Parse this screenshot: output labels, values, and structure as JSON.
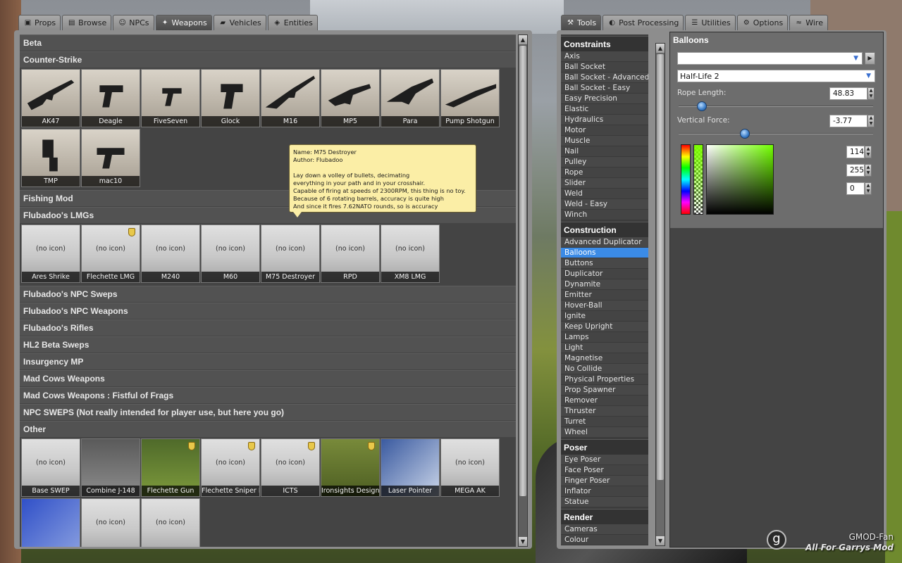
{
  "left_tabs": [
    {
      "label": "Props",
      "icon": "props-icon",
      "active": false
    },
    {
      "label": "Browse",
      "icon": "browse-icon",
      "active": false
    },
    {
      "label": "NPCs",
      "icon": "npcs-icon",
      "active": false
    },
    {
      "label": "Weapons",
      "icon": "weapons-icon",
      "active": true
    },
    {
      "label": "Vehicles",
      "icon": "vehicles-icon",
      "active": false
    },
    {
      "label": "Entities",
      "icon": "entities-icon",
      "active": false
    }
  ],
  "right_tabs": [
    {
      "label": "Tools",
      "icon": "wrench-icon",
      "active": true
    },
    {
      "label": "Post Processing",
      "icon": "post-processing-icon",
      "active": false
    },
    {
      "label": "Utilities",
      "icon": "utilities-icon",
      "active": false
    },
    {
      "label": "Options",
      "icon": "options-icon",
      "active": false
    },
    {
      "label": "Wire",
      "icon": "wire-icon",
      "active": false
    }
  ],
  "weapon_categories": [
    {
      "name": "Beta",
      "items": []
    },
    {
      "name": "Counter-Strike",
      "items": [
        {
          "label": "AK47",
          "icon": true,
          "admin": false
        },
        {
          "label": "Deagle",
          "icon": true,
          "admin": false
        },
        {
          "label": "FiveSeven",
          "icon": true,
          "admin": false
        },
        {
          "label": "Glock",
          "icon": true,
          "admin": false
        },
        {
          "label": "M16",
          "icon": true,
          "admin": false
        },
        {
          "label": "MP5",
          "icon": true,
          "admin": false
        },
        {
          "label": "Para",
          "icon": true,
          "admin": false
        },
        {
          "label": "Pump Shotgun",
          "icon": true,
          "admin": false
        },
        {
          "label": "TMP",
          "icon": true,
          "admin": false
        },
        {
          "label": "mac10",
          "icon": true,
          "admin": false
        }
      ]
    },
    {
      "name": "Fishing Mod",
      "items": []
    },
    {
      "name": "Flubadoo's LMGs",
      "items": [
        {
          "label": "Ares Shrike",
          "icon": false,
          "admin": false
        },
        {
          "label": "Flechette LMG",
          "icon": false,
          "admin": true
        },
        {
          "label": "M240",
          "icon": false,
          "admin": false
        },
        {
          "label": "M60",
          "icon": false,
          "admin": false
        },
        {
          "label": "M75 Destroyer",
          "icon": false,
          "admin": false
        },
        {
          "label": "RPD",
          "icon": false,
          "admin": false
        },
        {
          "label": "XM8 LMG",
          "icon": false,
          "admin": false
        }
      ]
    },
    {
      "name": "Flubadoo's NPC Sweps",
      "items": []
    },
    {
      "name": "Flubadoo's NPC Weapons",
      "items": []
    },
    {
      "name": "Flubadoo's Rifles",
      "items": []
    },
    {
      "name": "HL2 Beta Sweps",
      "items": []
    },
    {
      "name": "Insurgency MP",
      "items": []
    },
    {
      "name": "Mad Cows Weapons",
      "items": []
    },
    {
      "name": "Mad Cows Weapons : Fistful of Frags",
      "items": []
    },
    {
      "name": "NPC SWEPS (Not really intended for player use, but here you go)",
      "items": []
    },
    {
      "name": "Other",
      "items": [
        {
          "label": "Base SWEP",
          "icon": false,
          "admin": false
        },
        {
          "label": "Combine J-148",
          "icon": true,
          "admin": false
        },
        {
          "label": "Flechette Gun",
          "icon": true,
          "admin": true
        },
        {
          "label": "Flechette Sniper Rifl",
          "icon": false,
          "admin": true
        },
        {
          "label": "ICTS",
          "icon": false,
          "admin": true
        },
        {
          "label": "Ironsights Designer",
          "icon": true,
          "admin": true
        },
        {
          "label": "Laser Pointer",
          "icon": true,
          "admin": false
        },
        {
          "label": "MEGA AK",
          "icon": false,
          "admin": false
        },
        {
          "label": "",
          "icon": true,
          "admin": false
        },
        {
          "label": "",
          "icon": false,
          "admin": false
        },
        {
          "label": "",
          "icon": false,
          "admin": false
        }
      ]
    }
  ],
  "no_icon_text": "(no icon)",
  "tooltip": {
    "text": "Name: M75 Destroyer\nAuthor: Flubadoo\n\nLay down a volley of bullets, decimating\neverything in your path and in your crosshair.\nCapable of firing at speeds of 2300RPM, this thing is no toy.\nBecause of 6 rotating barrels, accuracy is quite high\nAnd since it fires 7.62NATO rounds, so is accuracy"
  },
  "tool_categories": [
    {
      "name": "Constraints",
      "items": [
        "Axis",
        "Ball Socket",
        "Ball Socket - Advanced",
        "Ball Socket - Easy",
        "Easy Precision",
        "Elastic",
        "Hydraulics",
        "Motor",
        "Muscle",
        "Nail",
        "Pulley",
        "Rope",
        "Slider",
        "Weld",
        "Weld - Easy",
        "Winch"
      ]
    },
    {
      "name": "Construction",
      "items": [
        "Advanced Duplicator",
        "Balloons",
        "Buttons",
        "Duplicator",
        "Dynamite",
        "Emitter",
        "Hover-Ball",
        "Ignite",
        "Keep Upright",
        "Lamps",
        "Light",
        "Magnetise",
        "No Collide",
        "Physical Properties",
        "Prop Spawner",
        "Remover",
        "Thruster",
        "Turret",
        "Wheel"
      ]
    },
    {
      "name": "Poser",
      "items": [
        "Eye Poser",
        "Face Poser",
        "Finger Poser",
        "Inflator",
        "Statue"
      ]
    },
    {
      "name": "Render",
      "items": [
        "Cameras",
        "Colour"
      ]
    }
  ],
  "selected_tool": "Balloons",
  "settings": {
    "title": "Balloons",
    "preset_value": "",
    "model_value": "Half-Life 2",
    "rope_length_label": "Rope Length:",
    "rope_length_value": "48.83",
    "rope_length_fraction": 0.12,
    "vertical_force_label": "Vertical Force:",
    "vertical_force_value": "-3.77",
    "vertical_force_fraction": 0.34,
    "color_r": "114",
    "color_g": "255",
    "color_b": "0"
  },
  "watermark": {
    "line1": "GMOD-Fan",
    "line2": "All For Garrys Mod",
    "logo": "g"
  },
  "colors": {
    "selection": "#3b8be6",
    "tooltip_bg": "#fbeea6",
    "panel": "#8d8d8d"
  }
}
